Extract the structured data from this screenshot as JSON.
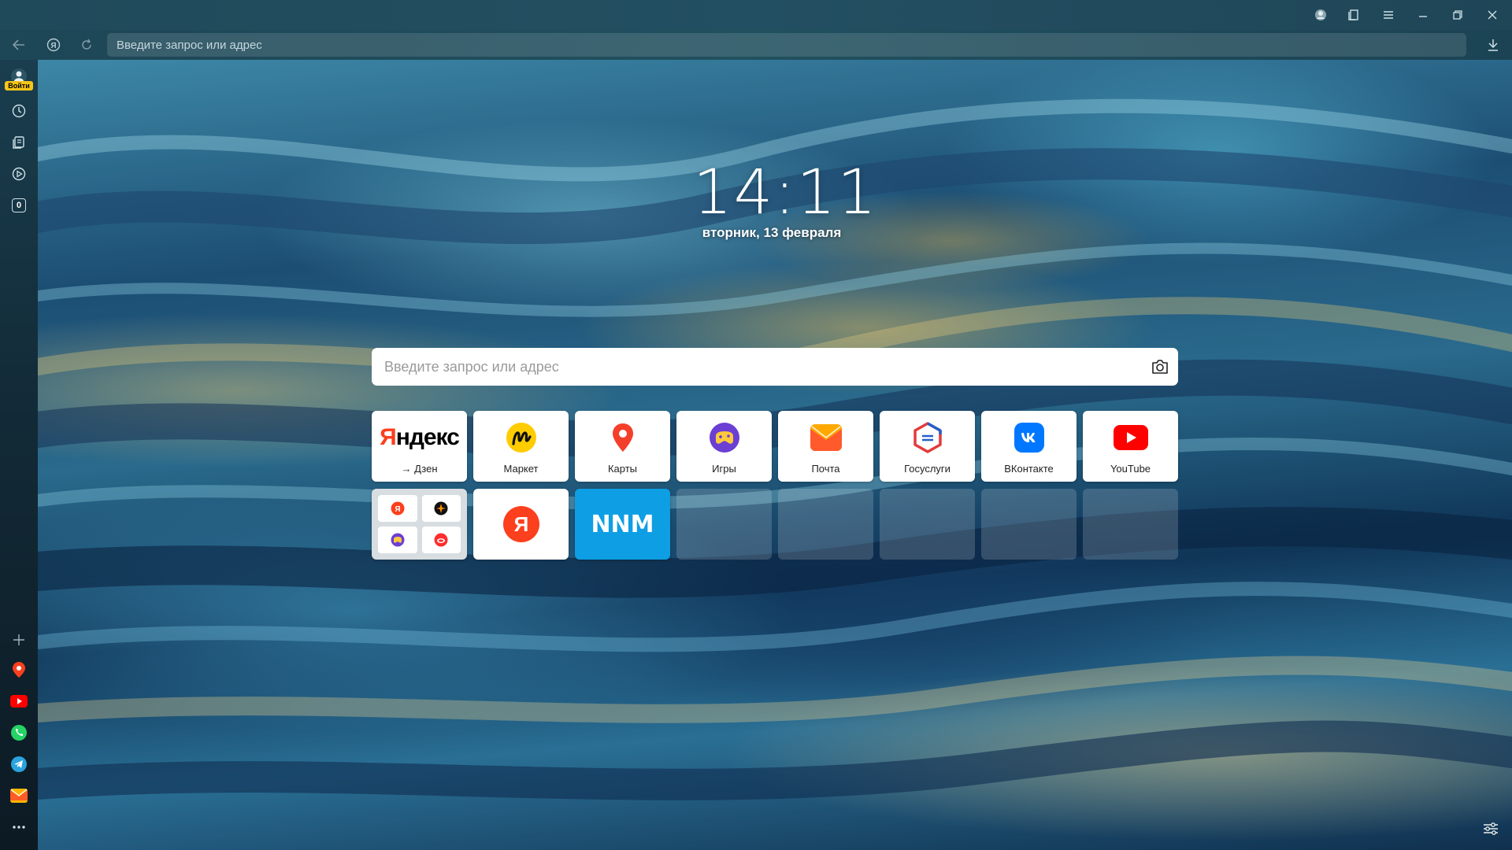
{
  "address_bar": {
    "placeholder": "Введите запрос или адрес"
  },
  "sidebar": {
    "login_label": "Войти",
    "counter_value": "0"
  },
  "clock": {
    "time": "14:11",
    "date": "вторник, 13 февраля"
  },
  "search": {
    "placeholder": "Введите запрос или адрес"
  },
  "tiles": [
    {
      "label": "→ Дзен",
      "logo_text": "Яндекс"
    },
    {
      "label": "Маркет"
    },
    {
      "label": "Карты"
    },
    {
      "label": "Игры"
    },
    {
      "label": "Почта"
    },
    {
      "label": "Госуслуги"
    },
    {
      "label": "ВКонтакте"
    },
    {
      "label": "YouTube"
    },
    {
      "label": ""
    },
    {
      "label": "",
      "logo_text": "Я"
    },
    {
      "label": "",
      "logo_text": "NNM"
    }
  ],
  "colors": {
    "yandex_red": "#fc3f1d",
    "nnm_blue": "#0e9ee4",
    "vk_blue": "#0077ff",
    "youtube_red": "#ff0000",
    "market_yellow": "#ffcc00"
  }
}
